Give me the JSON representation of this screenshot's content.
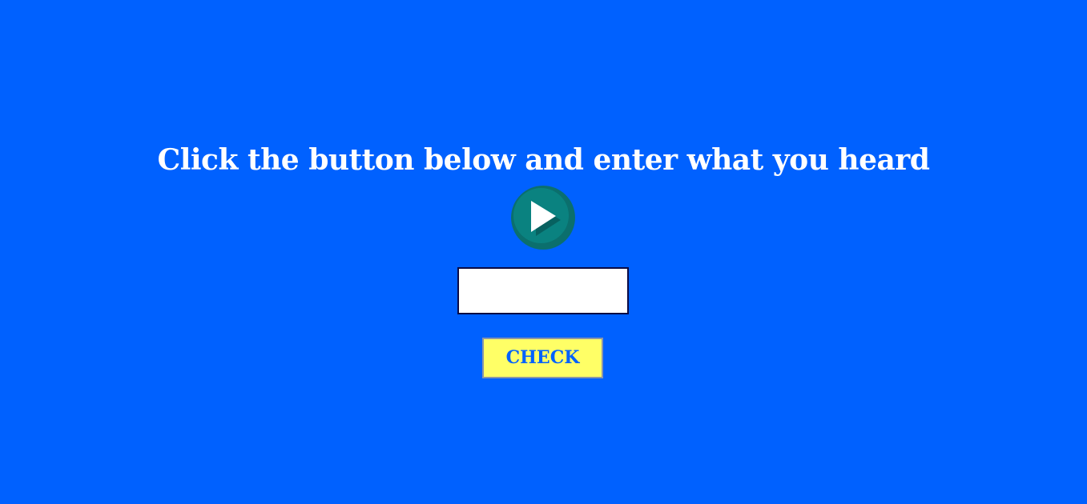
{
  "instruction": "Click the button below and enter what you heard",
  "play_button": {
    "icon": "play-icon"
  },
  "answer_input": {
    "value": "",
    "placeholder": ""
  },
  "check_button": {
    "label": "CHECK"
  },
  "colors": {
    "background": "#0061ff",
    "text": "#ffffff",
    "play_button": "#0a8280",
    "check_button": "#ffff66",
    "check_button_text": "#0061ff"
  }
}
